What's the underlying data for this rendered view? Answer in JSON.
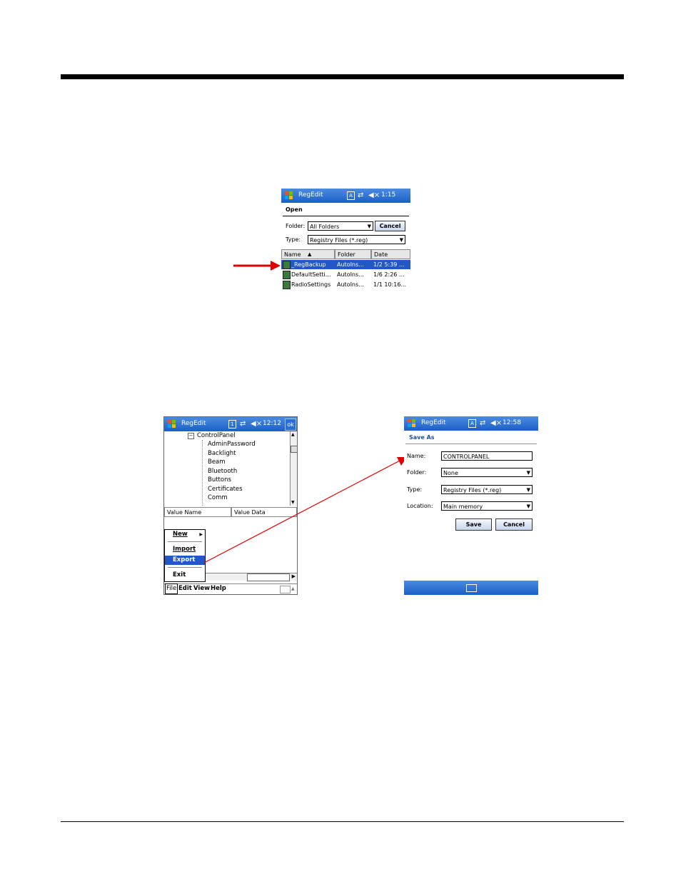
{
  "open_dialog": {
    "app_title": "RegEdit",
    "clock": "1:15",
    "heading": "Open",
    "folder_label": "Folder:",
    "folder_value": "All Folders",
    "cancel_label": "Cancel",
    "type_label": "Type:",
    "type_value": "Registry Files (*.reg)",
    "columns": [
      "Name",
      "Folder",
      "Date"
    ],
    "rows": [
      {
        "name": "_RegBackup",
        "folder": "AutoIns...",
        "date": "1/2 5:39 ..."
      },
      {
        "name": "DefaultSetti...",
        "folder": "AutoIns...",
        "date": "1/6 2:26 ..."
      },
      {
        "name": "RadioSettings",
        "folder": "AutoIns...",
        "date": "1/1 10:16..."
      }
    ]
  },
  "regedit_screen": {
    "app_title": "RegEdit",
    "clock": "12:12",
    "ok_label": "ok",
    "tree_root": "ControlPanel",
    "tree_children": [
      "AdminPassword",
      "Backlight",
      "Beam",
      "Bluetooth",
      "Buttons",
      "Certificates",
      "Comm"
    ],
    "value_columns": [
      "Value Name",
      "Value Data"
    ],
    "file_menu": {
      "new": "New",
      "import": "Import",
      "export": "Export",
      "exit": "Exit"
    },
    "menubar": [
      "File",
      "Edit",
      "View",
      "Help"
    ]
  },
  "save_as": {
    "app_title": "RegEdit",
    "clock": "12:58",
    "heading": "Save As",
    "name_label": "Name:",
    "name_value": "CONTROLPANEL",
    "folder_label": "Folder:",
    "folder_value": "None",
    "type_label": "Type:",
    "type_value": "Registry Files (*.reg)",
    "location_label": "Location:",
    "location_value": "Main memory",
    "save_label": "Save",
    "cancel_label": "Cancel"
  },
  "colors": {
    "titlebar": "#1c5fc6",
    "selection": "#2157c7",
    "arrow": "#e00000"
  },
  "icons": [
    "windows-start-icon",
    "connectivity-icon",
    "speaker-icon",
    "registry-file-icon",
    "keyboard-icon"
  ]
}
